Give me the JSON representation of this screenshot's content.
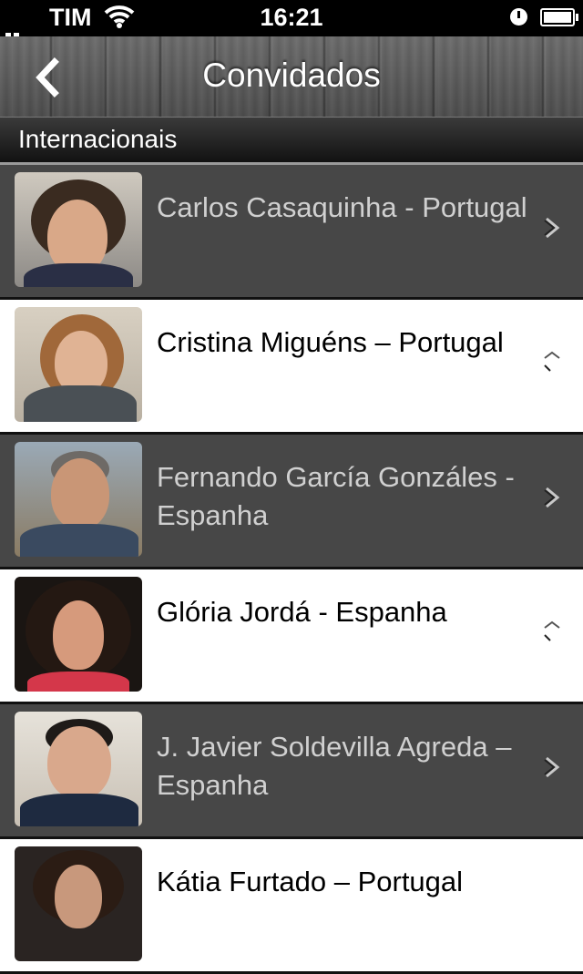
{
  "status_bar": {
    "carrier": "TIM",
    "time": "16:21"
  },
  "nav": {
    "back_icon": "chevron-left-icon",
    "title": "Convidados"
  },
  "section": {
    "title": "Internacionais"
  },
  "guests": [
    {
      "name": "Carlos Casaquinha - Portugal",
      "style": "dark"
    },
    {
      "name": "Cristina Miguéns – Portugal",
      "style": "light"
    },
    {
      "name": "Fernando García Gonzáles - Espanha",
      "style": "dark"
    },
    {
      "name": "Glória Jordá - Espanha",
      "style": "light"
    },
    {
      "name": "J. Javier Soldevilla Agreda – Espanha",
      "style": "dark"
    },
    {
      "name": "Kátia Furtado – Portugal",
      "style": "light"
    }
  ],
  "colors": {
    "row_dark": "#474747",
    "row_light": "#ffffff",
    "nav_wood": "#5a5a5a"
  }
}
